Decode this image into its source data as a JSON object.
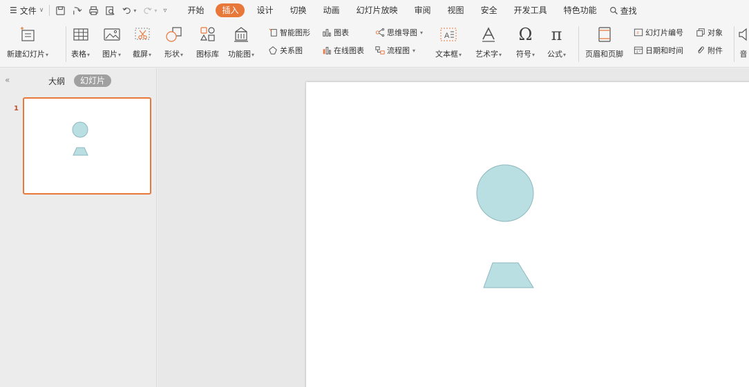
{
  "menubar": {
    "file_label": "文件",
    "tabs": [
      {
        "label": "开始"
      },
      {
        "label": "插入",
        "active": true
      },
      {
        "label": "设计"
      },
      {
        "label": "切换"
      },
      {
        "label": "动画"
      },
      {
        "label": "幻灯片放映"
      },
      {
        "label": "审阅"
      },
      {
        "label": "视图"
      },
      {
        "label": "安全"
      },
      {
        "label": "开发工具"
      },
      {
        "label": "特色功能"
      }
    ],
    "search_label": "查找"
  },
  "ribbon": {
    "new_slide": "新建幻灯片",
    "table": "表格",
    "picture": "图片",
    "screenshot": "截屏",
    "shape": "形状",
    "icon_library": "图标库",
    "function_chart": "功能图",
    "smart_art": "智能图形",
    "chart": "图表",
    "relation_chart": "关系图",
    "online_chart": "在线图表",
    "mind_map": "思维导图",
    "flowchart": "流程图",
    "text_box": "文本框",
    "word_art": "艺术字",
    "symbol": "符号",
    "formula": "公式",
    "header_footer": "页眉和页脚",
    "slide_number": "幻灯片编号",
    "object": "对象",
    "date_time": "日期和时间",
    "attachment": "附件",
    "audio_partial": "音"
  },
  "left_panel": {
    "outline_tab": "大纲",
    "slides_tab": "幻灯片",
    "slide_number": "1"
  },
  "colors": {
    "accent": "#e8773a",
    "shape_fill": "#b9dfe3",
    "shape_stroke": "#8fb8bd"
  }
}
